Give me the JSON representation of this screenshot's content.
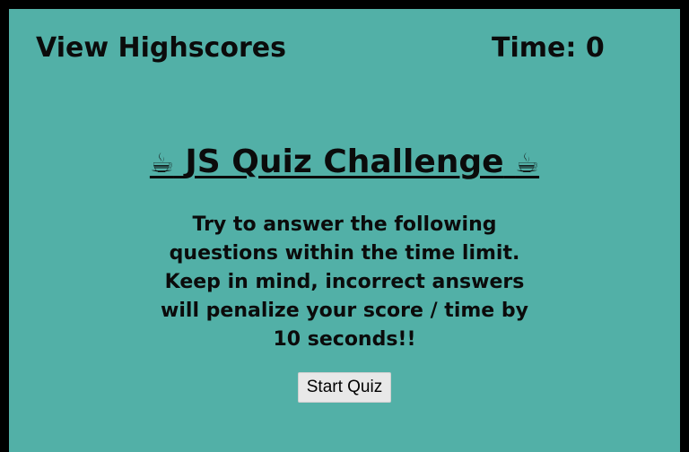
{
  "header": {
    "highscores_link": "View Highscores",
    "time_label": "Time:",
    "time_value": "0"
  },
  "main": {
    "title_text": "JS Quiz Challenge",
    "title_icon": "coffee-icon",
    "title_icon_glyph": "☕",
    "description": "Try to answer the following questions within the time limit. Keep in mind, incorrect answers will penalize your score / time by 10 seconds!!",
    "start_button": "Start Quiz"
  },
  "colors": {
    "background": "#52b0a7",
    "border": "#000000",
    "text": "#0b0b0b",
    "button_bg": "#e8e8e8"
  }
}
